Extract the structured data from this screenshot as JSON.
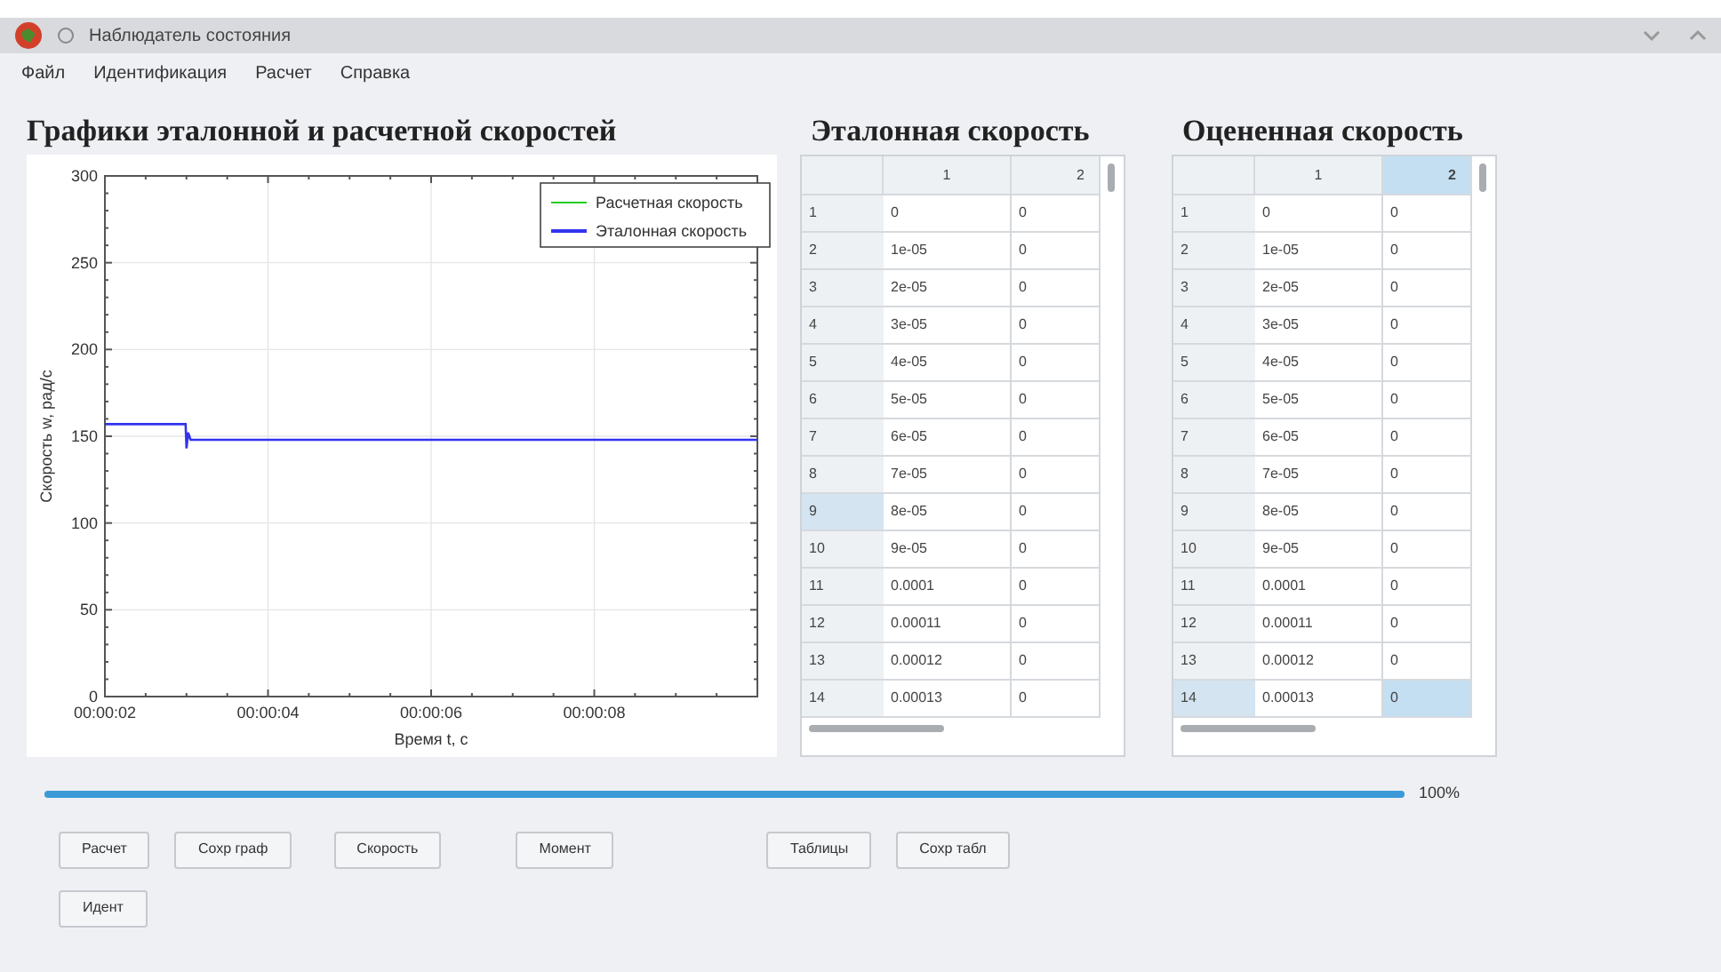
{
  "window": {
    "title": "Наблюдатель состояния"
  },
  "menu": [
    "Файл",
    "Идентификация",
    "Расчет",
    "Справка"
  ],
  "chart_panel": {
    "title": "Графики эталонной и расчетной скоростей",
    "chart_data": {
      "type": "line",
      "xlabel": "Время t, с",
      "ylabel": "Скорость w, рад/с",
      "x": [
        2,
        2.99,
        3.0,
        3.02,
        3.05,
        10
      ],
      "series": [
        {
          "name": "Расчетная скорость",
          "color": "#22cc22",
          "values": [
            null,
            null,
            null,
            null,
            null,
            null
          ]
        },
        {
          "name": "Эталонная скорость",
          "color": "#3333ee",
          "values": [
            157,
            157,
            143,
            152,
            148,
            148
          ]
        }
      ],
      "xlim": [
        2,
        10
      ],
      "ylim": [
        0,
        300
      ],
      "grid": true,
      "legend": true,
      "xticks": [
        {
          "value": 2,
          "label": "00:00:02"
        },
        {
          "value": 4,
          "label": "00:00:04"
        },
        {
          "value": 6,
          "label": "00:00:06"
        },
        {
          "value": 8,
          "label": "00:00:08"
        }
      ],
      "yticks": [
        0,
        50,
        100,
        150,
        200,
        250,
        300
      ]
    }
  },
  "tables": [
    {
      "title": "Эталонная скорость",
      "columns": [
        {
          "label": "1",
          "selected": false
        },
        {
          "label": "2",
          "selected": false
        }
      ],
      "rows": [
        {
          "label": "1",
          "cells": [
            "0",
            "0"
          ],
          "selected": false
        },
        {
          "label": "2",
          "cells": [
            "1e-05",
            "0"
          ],
          "selected": false
        },
        {
          "label": "3",
          "cells": [
            "2e-05",
            "0"
          ],
          "selected": false
        },
        {
          "label": "4",
          "cells": [
            "3e-05",
            "0"
          ],
          "selected": false
        },
        {
          "label": "5",
          "cells": [
            "4e-05",
            "0"
          ],
          "selected": false
        },
        {
          "label": "6",
          "cells": [
            "5e-05",
            "0"
          ],
          "selected": false
        },
        {
          "label": "7",
          "cells": [
            "6e-05",
            "0"
          ],
          "selected": false
        },
        {
          "label": "8",
          "cells": [
            "7e-05",
            "0"
          ],
          "selected": false
        },
        {
          "label": "9",
          "cells": [
            "8e-05",
            "0"
          ],
          "selected": true
        },
        {
          "label": "10",
          "cells": [
            "9e-05",
            "0"
          ],
          "selected": false
        },
        {
          "label": "11",
          "cells": [
            "0.0001",
            "0"
          ],
          "selected": false
        },
        {
          "label": "12",
          "cells": [
            "0.00011",
            "0"
          ],
          "selected": false
        },
        {
          "label": "13",
          "cells": [
            "0.00012",
            "0"
          ],
          "selected": false
        },
        {
          "label": "14",
          "cells": [
            "0.00013",
            "0"
          ],
          "selected": false
        }
      ]
    },
    {
      "title": "Оцененная скорость",
      "columns": [
        {
          "label": "1",
          "selected": false
        },
        {
          "label": "2",
          "selected": true
        }
      ],
      "rows": [
        {
          "label": "1",
          "cells": [
            "0",
            "0"
          ],
          "selected": false
        },
        {
          "label": "2",
          "cells": [
            "1e-05",
            "0"
          ],
          "selected": false
        },
        {
          "label": "3",
          "cells": [
            "2e-05",
            "0"
          ],
          "selected": false
        },
        {
          "label": "4",
          "cells": [
            "3e-05",
            "0"
          ],
          "selected": false
        },
        {
          "label": "5",
          "cells": [
            "4e-05",
            "0"
          ],
          "selected": false
        },
        {
          "label": "6",
          "cells": [
            "5e-05",
            "0"
          ],
          "selected": false
        },
        {
          "label": "7",
          "cells": [
            "6e-05",
            "0"
          ],
          "selected": false
        },
        {
          "label": "8",
          "cells": [
            "7e-05",
            "0"
          ],
          "selected": false
        },
        {
          "label": "9",
          "cells": [
            "8e-05",
            "0"
          ],
          "selected": false
        },
        {
          "label": "10",
          "cells": [
            "9e-05",
            "0"
          ],
          "selected": false
        },
        {
          "label": "11",
          "cells": [
            "0.0001",
            "0"
          ],
          "selected": false
        },
        {
          "label": "12",
          "cells": [
            "0.00011",
            "0"
          ],
          "selected": false
        },
        {
          "label": "13",
          "cells": [
            "0.00012",
            "0"
          ],
          "selected": false
        },
        {
          "label": "14",
          "cells": [
            "0.00013",
            "0"
          ],
          "selected": true
        }
      ]
    }
  ],
  "progress": {
    "level": 1,
    "reading": "100%"
  },
  "buttons_row_1": [
    {
      "label": "Расчет"
    },
    {
      "label": "Сохр граф"
    },
    {
      "label": "Скорость"
    },
    {
      "label": "Момент"
    },
    {
      "label": "Таблицы"
    },
    {
      "label": "Сохр табл"
    }
  ],
  "buttons_row_2": [
    {
      "label": "Идент"
    }
  ]
}
